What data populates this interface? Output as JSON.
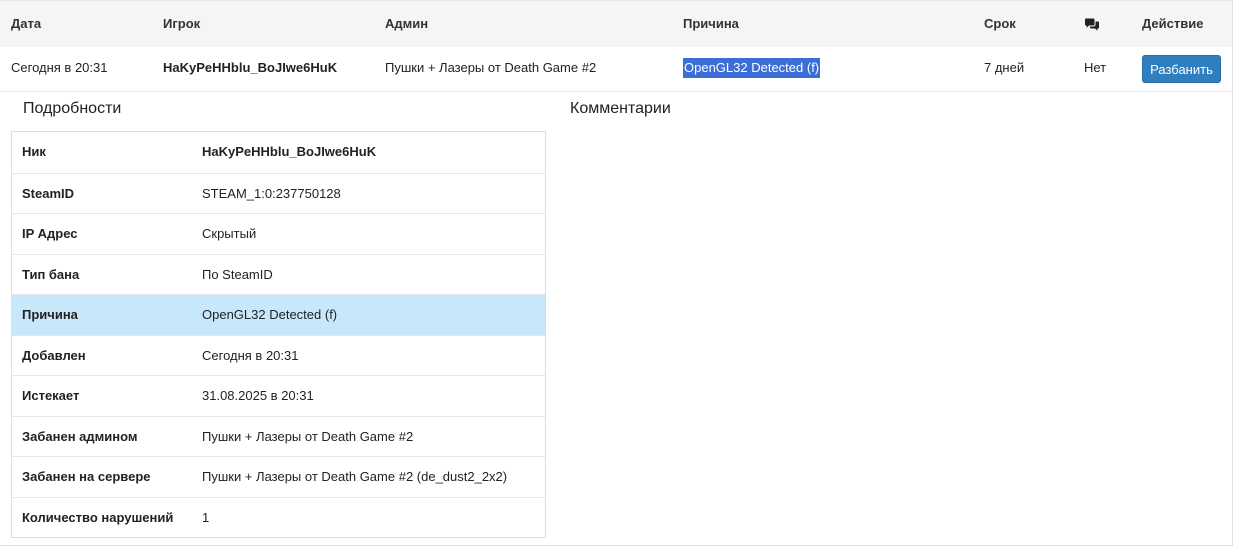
{
  "header": {
    "date": "Дата",
    "player": "Игрок",
    "admin": "Админ",
    "reason": "Причина",
    "term": "Срок",
    "comments_icon": "comments-icon",
    "action": "Действие"
  },
  "ban": {
    "date": "Сегодня в 20:31",
    "player": "HaKyPeHHblu_BoJIwe6HuK",
    "admin": "Пушки + Лазеры от Death Game #2",
    "reason": "OpenGL32 Detected (f)",
    "term": "7 дней",
    "comments": "Нет",
    "unban_label": "Разбанить"
  },
  "details": {
    "title": "Подробности",
    "rows": [
      {
        "label": "Ник",
        "value": "HaKyPeHHblu_BoJIwe6HuK"
      },
      {
        "label": "SteamID",
        "value": "STEAM_1:0:237750128"
      },
      {
        "label": "IP Адрес",
        "value": "Скрытый"
      },
      {
        "label": "Тип бана",
        "value": "По SteamID"
      },
      {
        "label": "Причина",
        "value": "OpenGL32 Detected (f)"
      },
      {
        "label": "Добавлен",
        "value": "Сегодня в 20:31"
      },
      {
        "label": "Истекает",
        "value": "31.08.2025 в 20:31"
      },
      {
        "label": "Забанен админом",
        "value": "Пушки + Лазеры от Death Game #2"
      },
      {
        "label": "Забанен на сервере",
        "value": "Пушки + Лазеры от Death Game #2 (de_dust2_2x2)"
      },
      {
        "label": "Количество нарушений",
        "value": "1"
      }
    ]
  },
  "comments": {
    "title": "Комментарии"
  },
  "colors": {
    "button": "#2f7ec0",
    "highlight_row": "#c7e7fb",
    "selection": "#3b6ed6"
  }
}
